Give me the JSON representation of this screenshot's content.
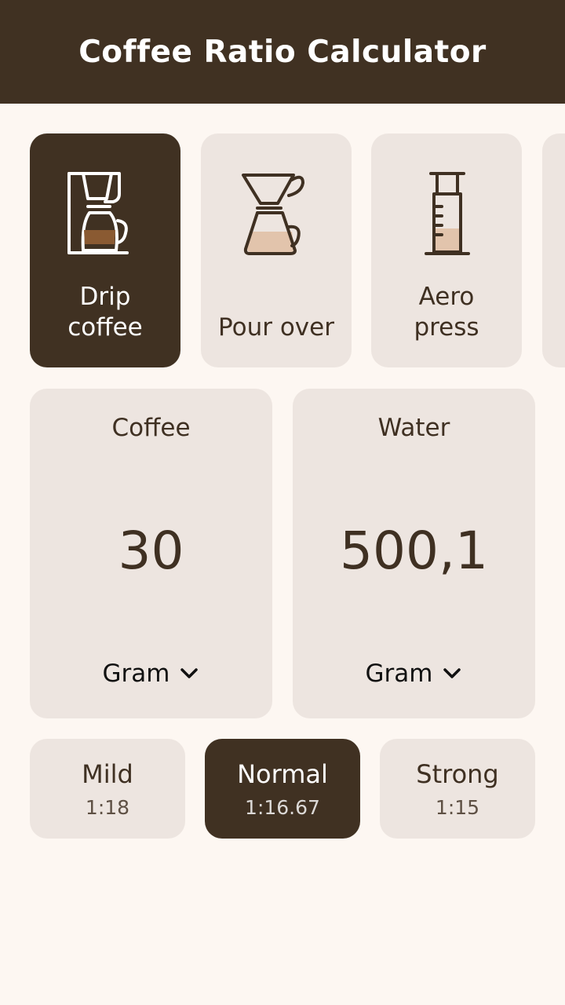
{
  "app_bar": {
    "title": "Coffee Ratio Calculator"
  },
  "methods": [
    {
      "label": "Drip\ncoffee",
      "icon": "drip-coffee-maker-icon",
      "selected": true
    },
    {
      "label": "Pour over",
      "icon": "pour-over-icon",
      "selected": false
    },
    {
      "label": "Aero\npress",
      "icon": "aeropress-icon",
      "selected": false
    }
  ],
  "coffee": {
    "title": "Coffee",
    "value": "30",
    "unit": "Gram"
  },
  "water": {
    "title": "Water",
    "value": "500,1",
    "unit": "Gram"
  },
  "strengths": [
    {
      "name": "Mild",
      "ratio": "1:18",
      "selected": false
    },
    {
      "name": "Normal",
      "ratio": "1:16.67",
      "selected": true
    },
    {
      "name": "Strong",
      "ratio": "1:15",
      "selected": false
    }
  ],
  "colors": {
    "primary": "#403122",
    "background": "#FDF7F2",
    "card": "#EDE5E0",
    "coffee_fill": "#8A5A32",
    "milk_fill": "#E2C4AC"
  }
}
